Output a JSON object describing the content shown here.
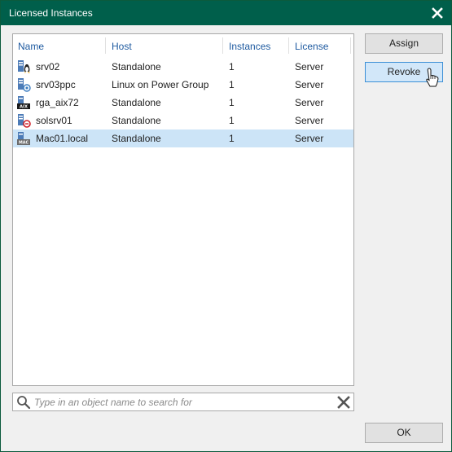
{
  "window": {
    "title": "Licensed Instances"
  },
  "table": {
    "columns": [
      "Name",
      "Host",
      "Instances",
      "License"
    ],
    "rows": [
      {
        "icon": "linux-server-icon",
        "name": "srv02",
        "host": "Standalone",
        "instances": "1",
        "license": "Server",
        "selected": false
      },
      {
        "icon": "power-server-icon",
        "name": "srv03ppc",
        "host": "Linux on Power Group",
        "instances": "1",
        "license": "Server",
        "selected": false
      },
      {
        "icon": "aix-server-icon",
        "name": "rga_aix72",
        "host": "Standalone",
        "instances": "1",
        "license": "Server",
        "selected": false
      },
      {
        "icon": "solaris-server-icon",
        "name": "solsrv01",
        "host": "Standalone",
        "instances": "1",
        "license": "Server",
        "selected": false
      },
      {
        "icon": "mac-server-icon",
        "name": "Mac01.local",
        "host": "Standalone",
        "instances": "1",
        "license": "Server",
        "selected": true
      }
    ]
  },
  "buttons": {
    "assign": "Assign",
    "revoke": "Revoke",
    "ok": "OK"
  },
  "search": {
    "placeholder": "Type in an object name to search for",
    "value": ""
  },
  "colors": {
    "titlebar": "#005f4b",
    "header_text": "#1e5aa0",
    "selection": "#cce4f7"
  }
}
